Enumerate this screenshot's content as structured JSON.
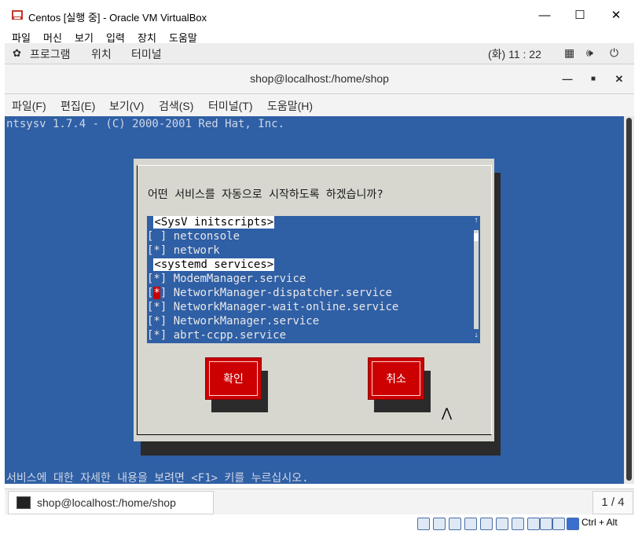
{
  "vbox": {
    "title": "Centos [실행 중] - Oracle VM VirtualBox",
    "menu": [
      "파일",
      "머신",
      "보기",
      "입력",
      "장치",
      "도움말"
    ],
    "host_key": "Ctrl + Alt"
  },
  "gnome": {
    "apps": "프로그램",
    "places": "위치",
    "terminal": "터미널",
    "clock": "(화) 11 : 22"
  },
  "terminal": {
    "title": "shop@localhost:/home/shop",
    "menu": [
      "파일(F)",
      "편집(E)",
      "보기(V)",
      "검색(S)",
      "터미널(T)",
      "도움말(H)"
    ],
    "tab_label": "shop@localhost:/home/shop",
    "page_indicator": "1 / 4"
  },
  "ntsysv": {
    "header": "ntsysv 1.7.4 - (C) 2000-2001 Red Hat, Inc.",
    "prompt": "어떤 서비스를 자동으로 시작하도록 하겠습니까?",
    "footer": "서비스에 대한 자세한 내용을 보려면 <F1> 키를 누르십시오.",
    "list_scroll_fraction": 0.02,
    "rows": [
      {
        "text": "<SysV initscripts>",
        "kind": "category"
      },
      {
        "mark": "[ ]",
        "text": "netconsole",
        "kind": "item",
        "checked": false
      },
      {
        "mark": "[*]",
        "text": "network",
        "kind": "item",
        "checked": true
      },
      {
        "text": "<systemd services>",
        "kind": "category"
      },
      {
        "mark": "[*]",
        "text": "ModemManager.service",
        "kind": "item",
        "checked": true
      },
      {
        "mark": "[*]",
        "text": "NetworkManager-dispatcher.service",
        "kind": "item",
        "checked": true,
        "focused": true
      },
      {
        "mark": "[*]",
        "text": "NetworkManager-wait-online.service",
        "kind": "item",
        "checked": true
      },
      {
        "mark": "[*]",
        "text": "NetworkManager.service",
        "kind": "item",
        "checked": true
      },
      {
        "mark": "[*]",
        "text": "abrt-ccpp.service",
        "kind": "item",
        "checked": true
      }
    ],
    "ok_label": "확인",
    "cancel_label": "취소"
  },
  "colors": {
    "console_bg": "#2f5fa5",
    "dialog_bg": "#d7d7d0",
    "button_red": "#cc0000"
  }
}
